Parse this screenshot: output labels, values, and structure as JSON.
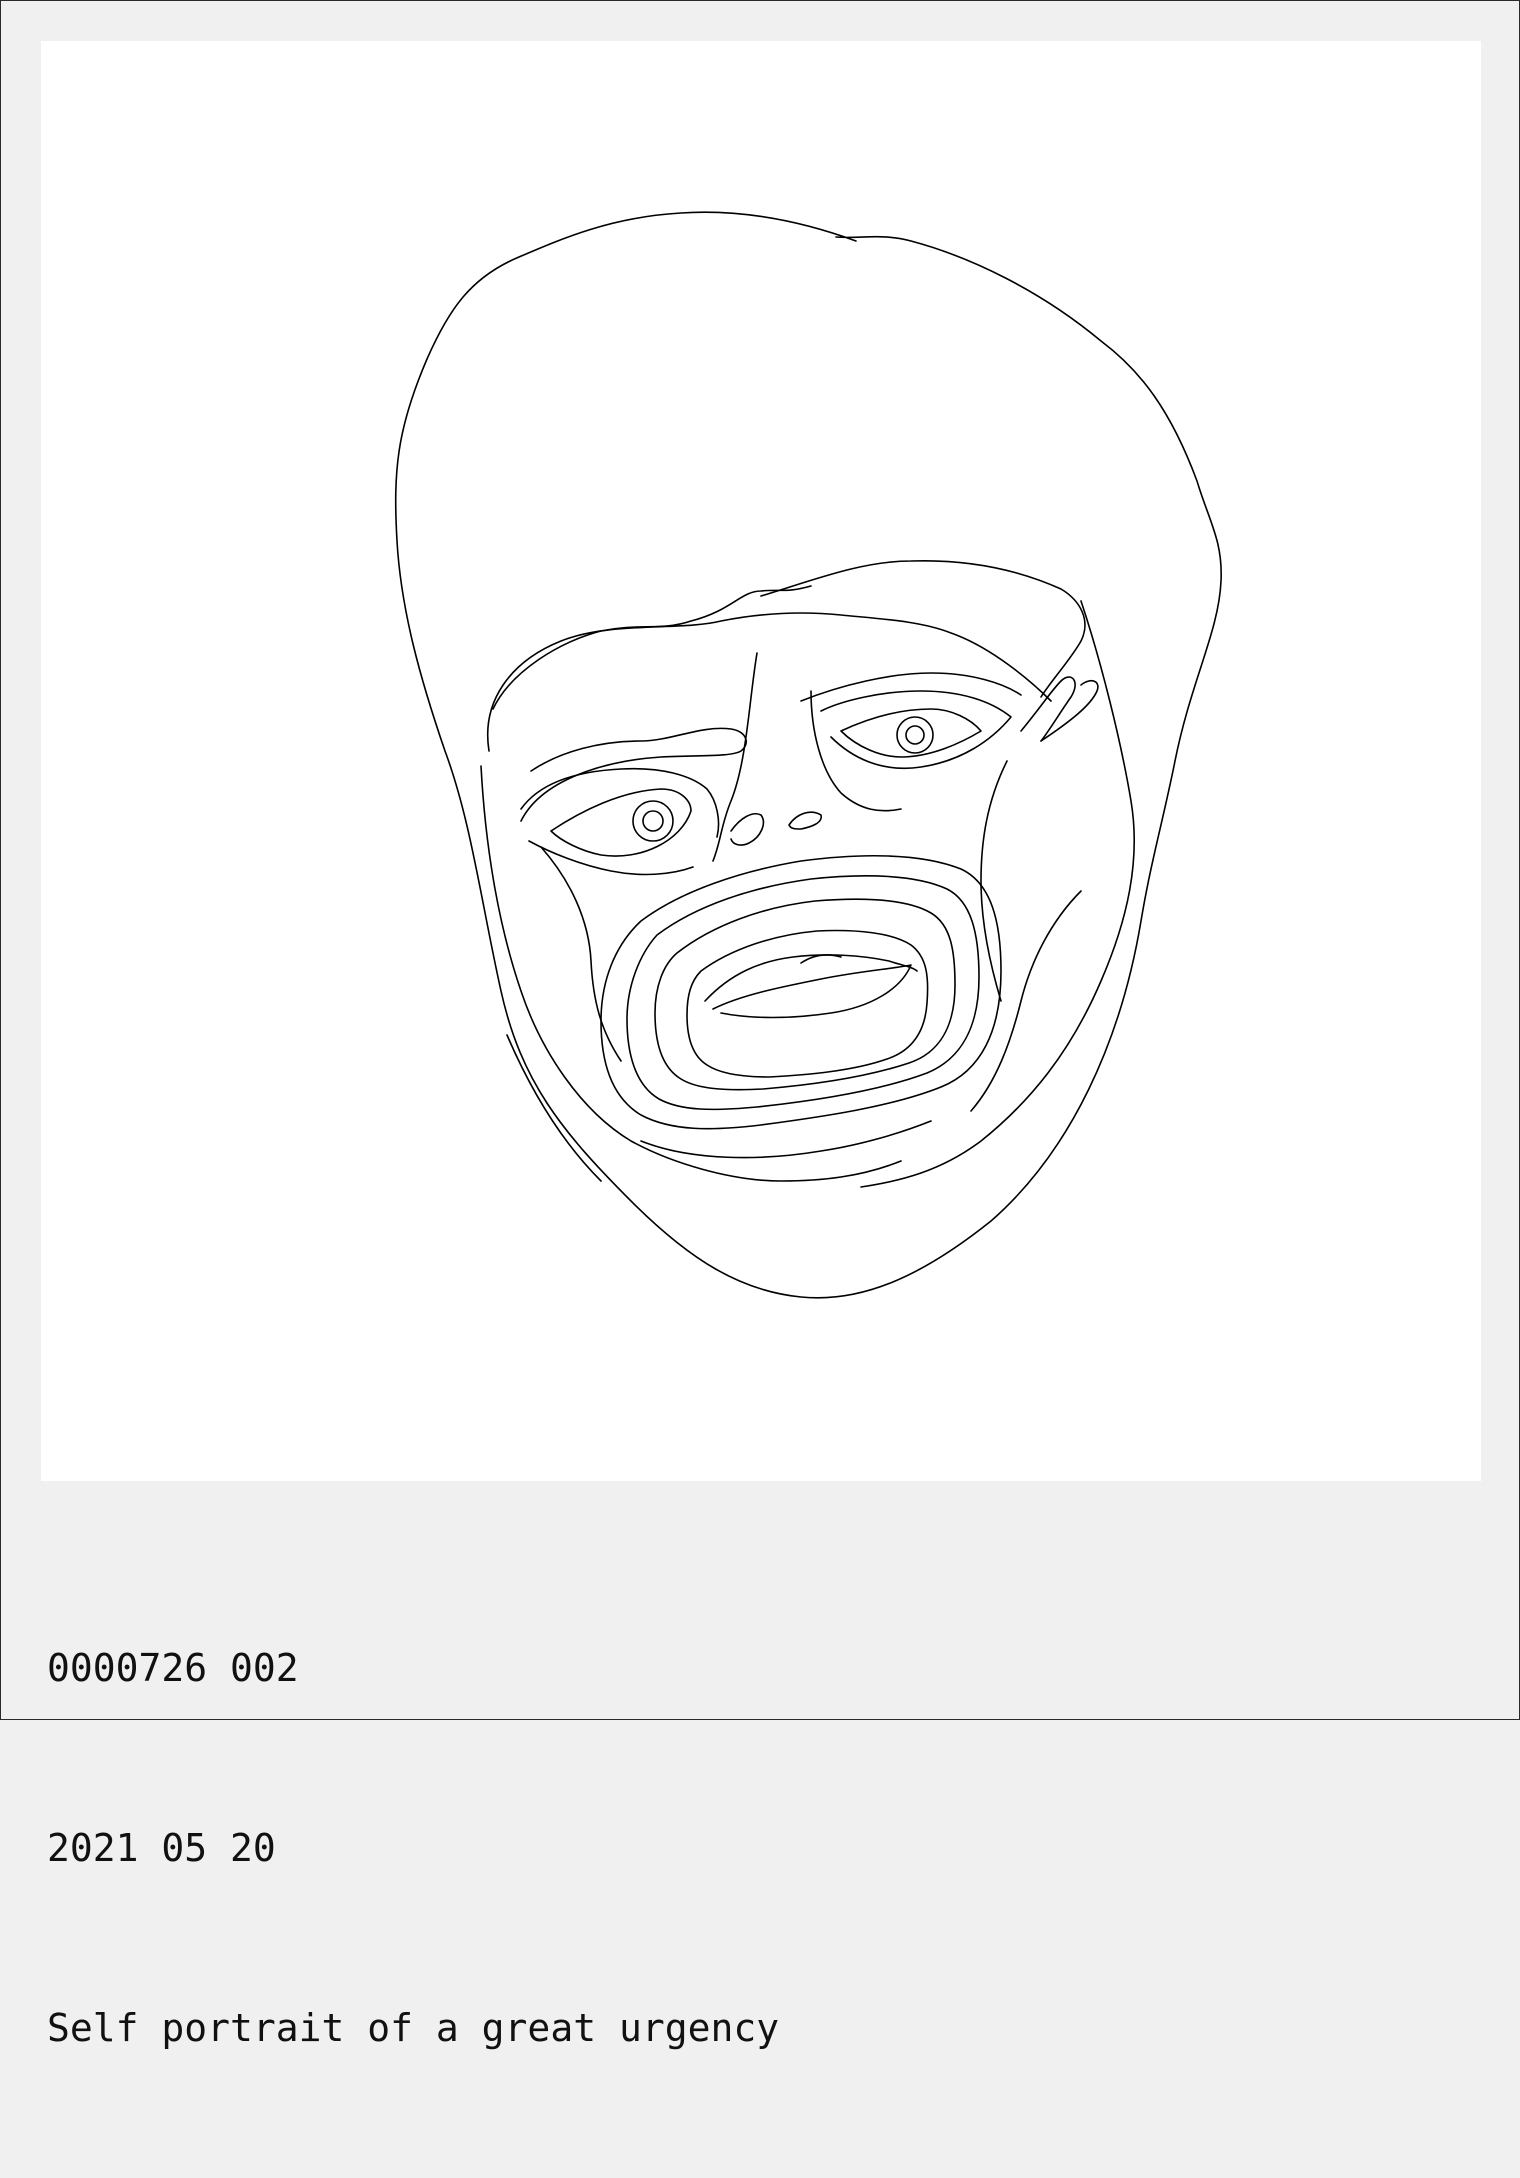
{
  "caption": {
    "id": "0000726 002",
    "date": "2021 05 20",
    "title": "Self portrait of a great urgency"
  }
}
